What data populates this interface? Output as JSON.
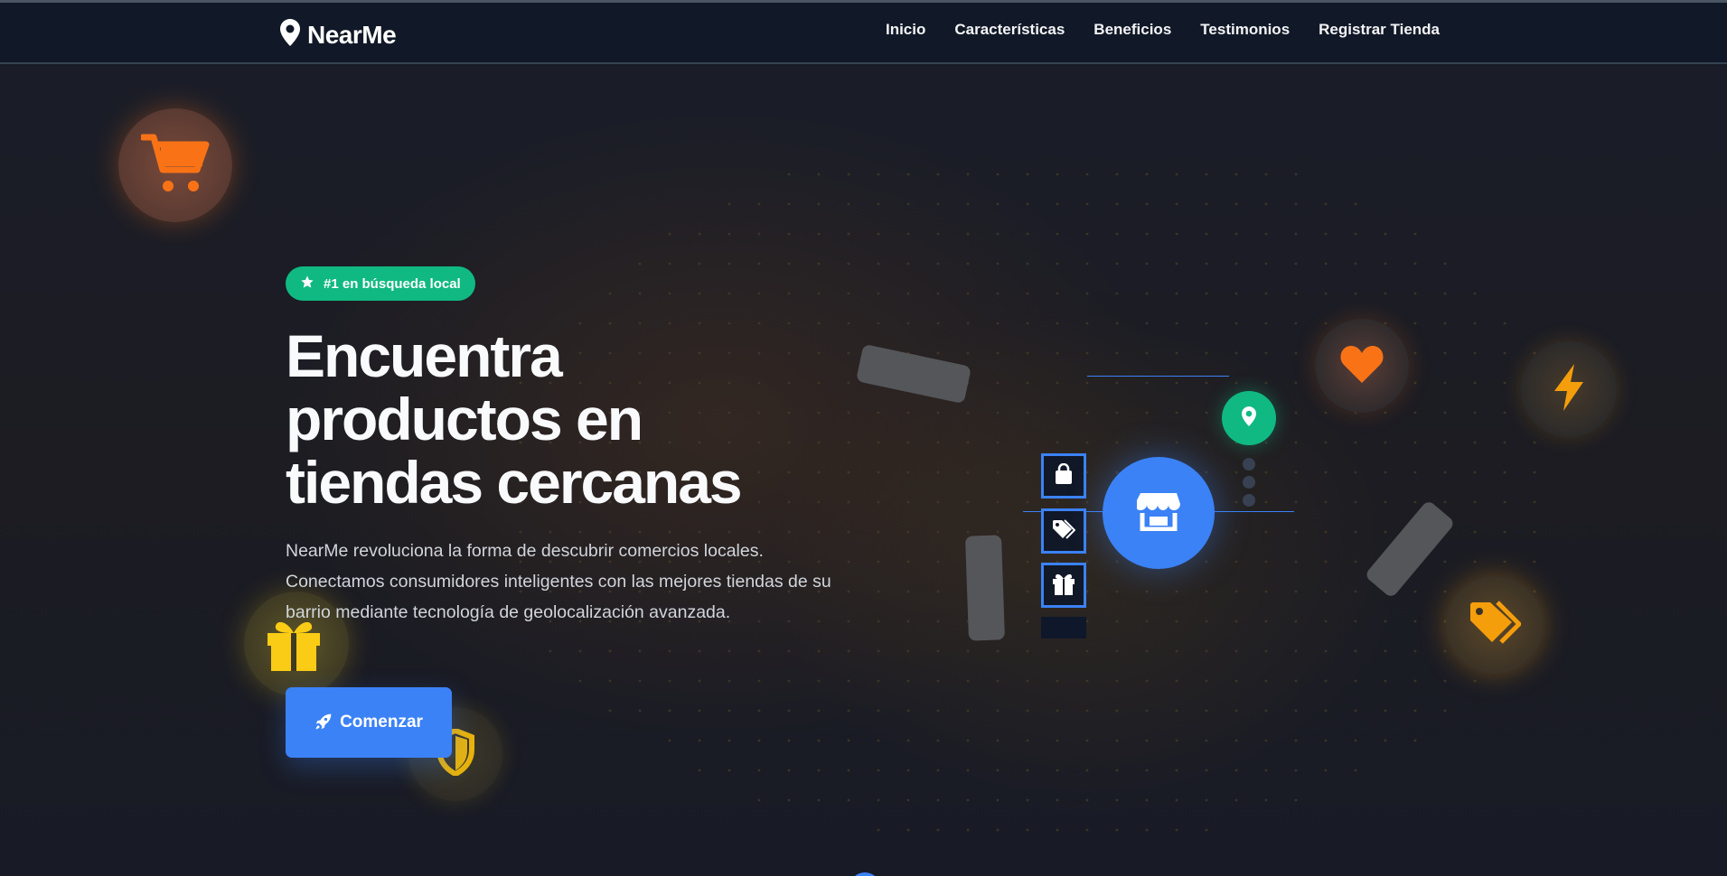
{
  "brand": {
    "name": "NearMe",
    "logo_icon": "map-pin-icon"
  },
  "nav": {
    "items": [
      {
        "label": "Inicio"
      },
      {
        "label": "Características"
      },
      {
        "label": "Beneficios"
      },
      {
        "label": "Testimonios"
      },
      {
        "label": "Registrar Tienda"
      }
    ]
  },
  "hero": {
    "badge": {
      "icon": "star-icon",
      "text": "#1 en búsqueda local"
    },
    "title": "Encuentra productos en tiendas cercanas",
    "description": "NearMe revoluciona la forma de descubrir comercios locales. Conectamos consumidores inteligentes con las mejores tiendas de su barrio mediante tecnología de geolocalización avanzada.",
    "cta": {
      "icon": "rocket-icon",
      "label": "Comenzar"
    }
  },
  "decor": {
    "floating_icons": [
      "cart-icon",
      "gift-icon",
      "shield-icon",
      "heart-icon",
      "bolt-icon",
      "tags-icon"
    ],
    "hub_icon": "store-icon",
    "pin_icon": "map-pin-icon",
    "category_icons": [
      "shopping-bag-icon",
      "tags-icon",
      "gift-icon"
    ]
  },
  "colors": {
    "primary": "#3b82f6",
    "accent_green": "#10b981",
    "orange": "#f97316",
    "yellow": "#facc15",
    "amber": "#f59e0b",
    "background": "#161b27",
    "navbar": "#111827"
  }
}
